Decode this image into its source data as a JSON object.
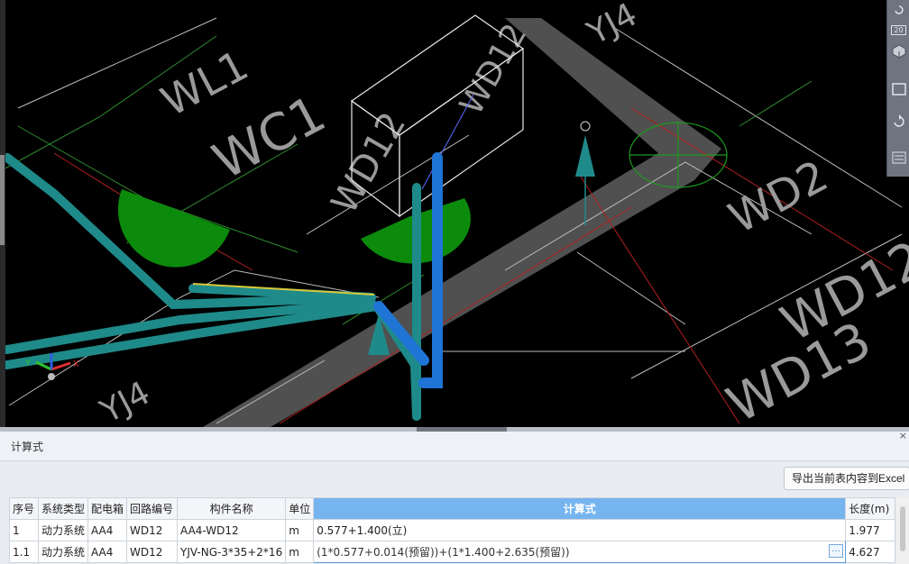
{
  "viewport": {
    "labels": [
      "WL1",
      "WC1",
      "WD2",
      "WD12",
      "WD12",
      "WD13",
      "WD12",
      "YJ4",
      "YJ4"
    ],
    "axis": {
      "x": "X",
      "y": "Y"
    },
    "colors": {
      "pipe_teal": "#1f8a8a",
      "pipe_blue": "#1f74d6",
      "fill_green": "#0c8a0c",
      "wall_gray": "#6a6a6a"
    }
  },
  "toolbar": {
    "icons": [
      "rotate-icon",
      "zoom-icon",
      "view-cube-icon",
      "box-icon",
      "refresh-icon",
      "layers-icon"
    ],
    "zoom_text": "20"
  },
  "panel": {
    "title": "计算式",
    "close_label": "×",
    "export_label": "导出当前表内容到Excel"
  },
  "table": {
    "columns": [
      "序号",
      "系统类型",
      "配电箱",
      "回路编号",
      "构件名称",
      "单位",
      "计算式",
      "长度(m)"
    ],
    "rows": [
      {
        "index": "1",
        "system": "动力系统",
        "box": "AA4",
        "circuit": "WD12",
        "name": "AA4-WD12",
        "unit": "m",
        "formula": "0.577+1.400(立)",
        "length": "1.977"
      },
      {
        "index": "1.1",
        "system": "动力系统",
        "box": "AA4",
        "circuit": "WD12",
        "name": "YJV-NG-3*35+2*16",
        "unit": "m",
        "formula": "(1*0.577+0.014(预留))+(1*1.400+2.635(预留))",
        "length": "4.627"
      }
    ],
    "ellipsis_label": "···"
  }
}
